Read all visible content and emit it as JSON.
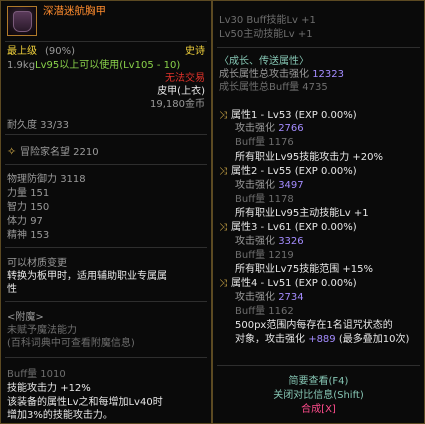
{
  "left": {
    "item_name": "深潜迷航胸甲",
    "grade_label": "最上级",
    "grade_pct": "(90%)",
    "rarity": "史诗",
    "weight": "1.9kg",
    "level_req": "Lv95以上可以使用(Lv105 - 10)",
    "trade": "无法交易",
    "type": "皮甲(上衣)",
    "price": "19,180金币",
    "durability": "耐久度 33/33",
    "adventurer_fame": "冒险家名望 2210",
    "defense_label": "物理防御力",
    "defense_value": "3118",
    "str_label": "力量",
    "str_value": "151",
    "int_label": "智力",
    "int_value": "150",
    "vit_label": "体力",
    "vit_value": "97",
    "spr_label": "精神",
    "spr_value": "153",
    "material_change": "可以材质变更",
    "convert_note_1": "转换为板甲时，适用辅助职业专属属",
    "convert_note_2": "性",
    "enchant_header": "<附魔>",
    "enchant_none": "未赋予魔法能力",
    "enchant_hint": "(百科词典中可查看附魔信息)",
    "buff_label": "Buff量",
    "buff_value": "1010",
    "skill_atk_label": "技能攻击力",
    "skill_atk_value": "+12%",
    "desc_1": "该装备的属性Lv之和每增加Lv40时",
    "desc_2": "增加3%的技能攻击力。"
  },
  "right": {
    "lv30": "Lv30 Buff技能Lv +1",
    "lv50": "Lv50主动技能Lv +1",
    "growth_header": "〈成长、传送属性〉",
    "growth_atk_label": "成长属性总攻击强化",
    "growth_atk_value": "12323",
    "growth_buff": "成长属性总Buff量 4735",
    "attrs": [
      {
        "title": "属性1 - Lv53 (EXP 0.00%)",
        "atk_label": "攻击强化",
        "atk": "2766",
        "buff": "Buff量 1176",
        "effect": "所有职业Lv95技能攻击力 +20%"
      },
      {
        "title": "属性2 - Lv55 (EXP 0.00%)",
        "atk_label": "攻击强化",
        "atk": "3497",
        "buff": "Buff量 1178",
        "effect": "所有职业Lv95主动技能Lv +1"
      },
      {
        "title": "属性3 - Lv61 (EXP 0.00%)",
        "atk_label": "攻击强化",
        "atk": "3326",
        "buff": "Buff量 1219",
        "effect": "所有职业Lv75技能范围 +15%"
      },
      {
        "title": "属性4 - Lv51 (EXP 0.00%)",
        "atk_label": "攻击强化",
        "atk": "2734",
        "buff": "Buff量 1162",
        "effect_1": "500px范围内每存在1名诅咒状态的",
        "effect_2": "对象，攻击强化",
        "effect_2_value": "+889",
        "effect_2_tail": "(最多叠加10次)"
      }
    ],
    "brief_view": "简要查看(F4)",
    "close_compare": "关闭对比信息(Shift)",
    "synthesize": "合成[X]"
  },
  "colors": {
    "frame": "#5c4a22",
    "gold": "#d8b04a",
    "rarity": "#f2d23c",
    "untradeable": "#e2322a",
    "level": "#8ad24a",
    "attr_value": "#a48cff",
    "growth": "#86c6b4"
  }
}
